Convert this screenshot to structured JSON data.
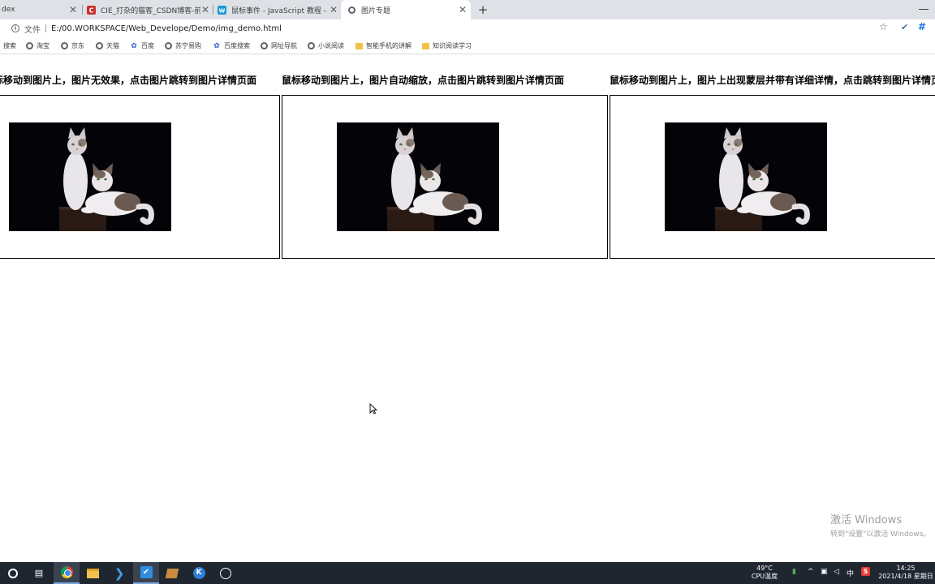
{
  "browser": {
    "tabs": [
      {
        "title": "dex",
        "favicon": "index-favicon",
        "active": false
      },
      {
        "title": "CIE_打杂的猫客_CSDN博客-前端",
        "favicon": "csdn-icon",
        "active": false
      },
      {
        "title": "鼠标事件 - JavaScript 教程 - 网道",
        "favicon": "wangdoc-icon",
        "active": false
      },
      {
        "title": "图片专题",
        "favicon": "globe-icon",
        "active": true
      }
    ],
    "close_glyph": "✕",
    "new_tab_glyph": "+",
    "address": {
      "scheme_label": "文件",
      "url": "E:/00.WORKSPACE/Web_Develope/Demo/img_demo.html"
    },
    "bookmarks": [
      {
        "label": "搜索",
        "icon": "globe-icon"
      },
      {
        "label": "淘宝",
        "icon": "globe-icon"
      },
      {
        "label": "京东",
        "icon": "globe-icon"
      },
      {
        "label": "天猫",
        "icon": "globe-icon"
      },
      {
        "label": "百度",
        "icon": "paw-icon"
      },
      {
        "label": "苏宁易购",
        "icon": "globe-icon"
      },
      {
        "label": "百度搜索",
        "icon": "paw-icon"
      },
      {
        "label": "网址导航",
        "icon": "globe-icon"
      },
      {
        "label": "小说阅读",
        "icon": "globe-icon"
      },
      {
        "label": "智能手机的讲解",
        "icon": "folder-icon"
      },
      {
        "label": "知识阅读学习",
        "icon": "folder-icon"
      }
    ]
  },
  "page": {
    "sections": [
      {
        "heading": "鼠标移动到图片上，图片无效果，点击图片跳转到图片详情页面"
      },
      {
        "heading": "鼠标移动到图片上，图片自动缩放，点击图片跳转到图片详情页面"
      },
      {
        "heading": "鼠标移动到图片上，图片上出现蒙层并带有详细详情，点击跳转到图片详情页面"
      }
    ]
  },
  "watermark": {
    "line1": "激活 Windows",
    "line2": "转到\"设置\"以激活 Windows。"
  },
  "taskbar": {
    "cpu_temp": "49°C",
    "cpu_label": "CPU温度",
    "ime": "中",
    "time": "14:25",
    "date": "2021/4/18 星期日"
  },
  "colors": {
    "tabstrip": "#dee1e6",
    "taskbar": "#1f2630",
    "csdn_red": "#c9302c",
    "wangdoc_blue": "#1d9bd1"
  }
}
